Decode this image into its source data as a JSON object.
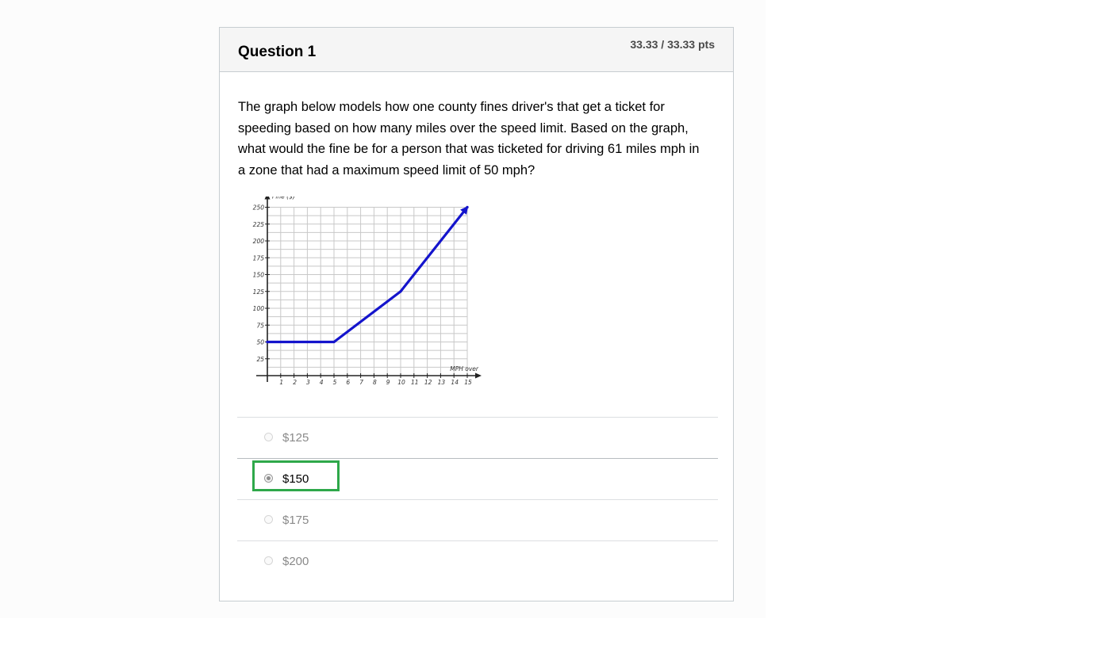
{
  "question": {
    "title": "Question 1",
    "points": "33.33 / 33.33 pts",
    "text": "The graph below models how one county fines driver's that get a ticket for speeding based on how many miles over the speed limit. Based on the graph, what would the fine be for a person that was ticketed for driving 61 miles mph in a zone that had a maximum speed limit of 50 mph?"
  },
  "chart_data": {
    "type": "line",
    "ylabel": "Fine ($)",
    "xlabel": "MPH over",
    "x_ticks": [
      "1",
      "2",
      "3",
      "4",
      "5",
      "6",
      "7",
      "8",
      "9",
      "10",
      "11",
      "12",
      "13",
      "14",
      "15"
    ],
    "y_ticks": [
      "25",
      "50",
      "75",
      "100",
      "125",
      "150",
      "175",
      "200",
      "225",
      "250"
    ],
    "xlim": [
      0,
      15
    ],
    "ylim": [
      0,
      250
    ],
    "grid": true,
    "series": [
      {
        "color": "#1414cc",
        "x": [
          0,
          5,
          10,
          15
        ],
        "y": [
          50,
          50,
          125,
          250
        ],
        "arrow_end": true
      }
    ]
  },
  "answers": [
    {
      "label": "$125",
      "selected": false,
      "correct": false
    },
    {
      "label": "$150",
      "selected": true,
      "correct": true
    },
    {
      "label": "$175",
      "selected": false,
      "correct": false
    },
    {
      "label": "$200",
      "selected": false,
      "correct": false
    }
  ],
  "colors": {
    "correct_highlight": "#2ea84a",
    "line": "#1414cc"
  }
}
